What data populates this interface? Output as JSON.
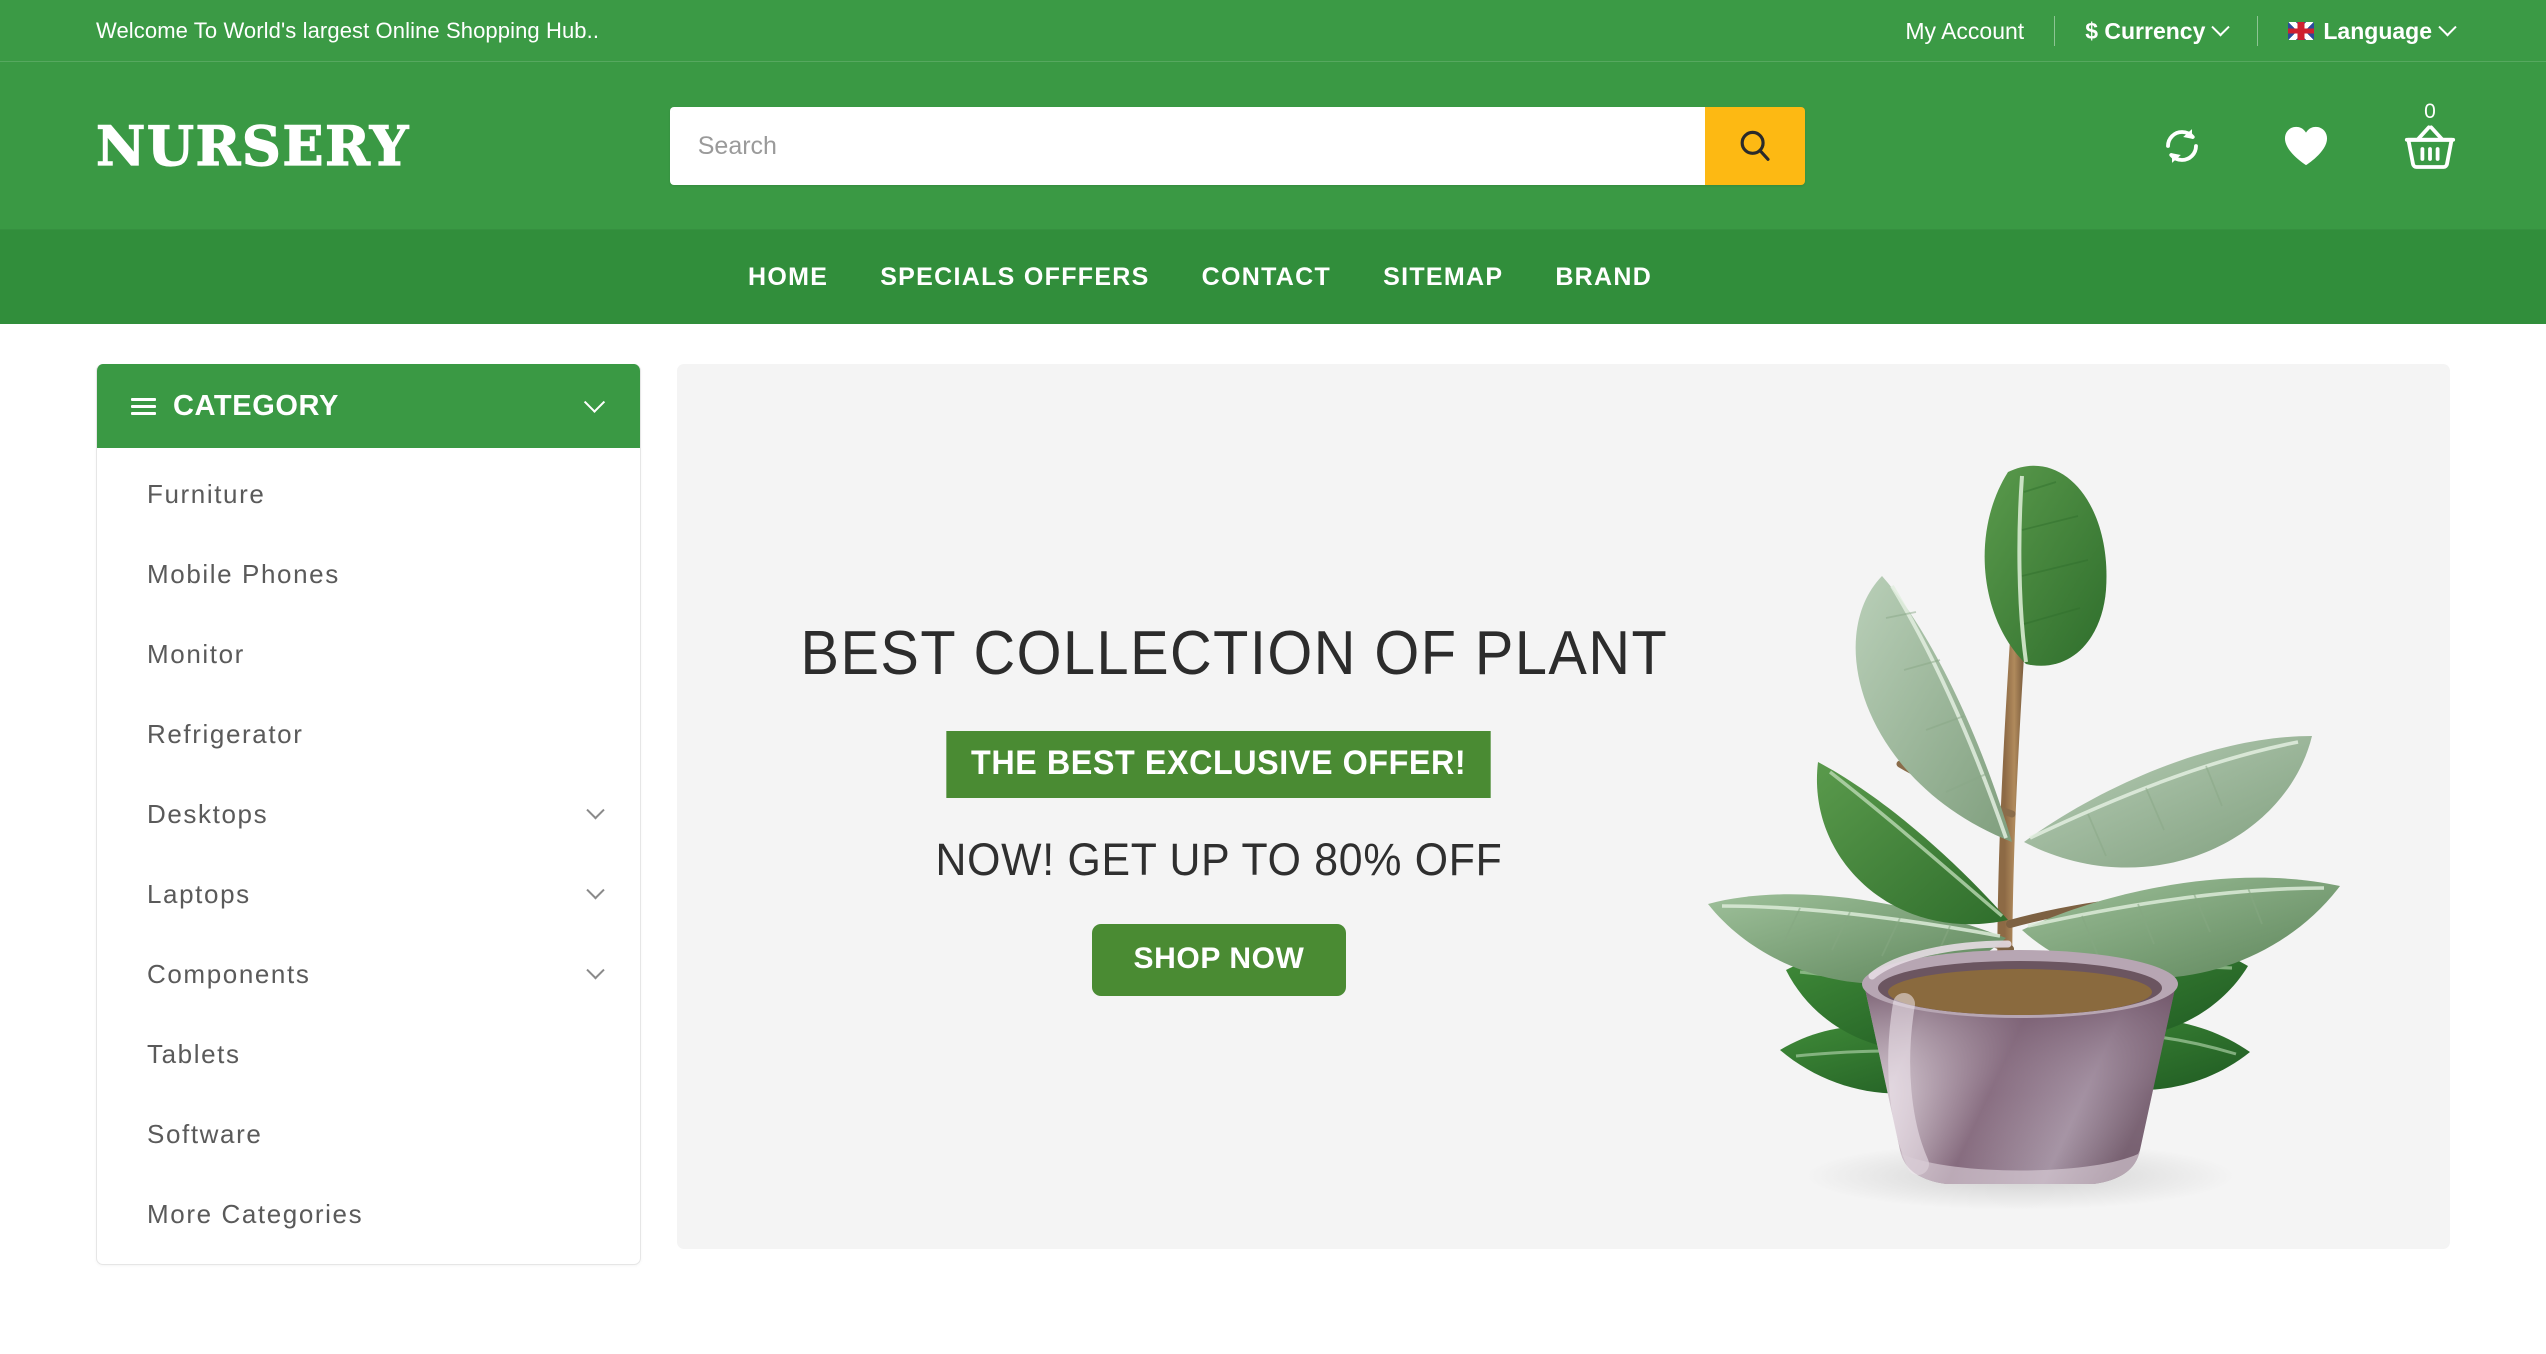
{
  "topbar": {
    "welcome": "Welcome To World's largest Online Shopping Hub..",
    "my_account": "My Account",
    "currency": "$ Currency",
    "language": "Language",
    "flag_icon": "uk-flag-icon",
    "caret_icon": "chevron-down-icon"
  },
  "header": {
    "logo": "NURSERY",
    "search_placeholder": "Search",
    "search_value": "",
    "search_icon": "search-icon",
    "compare_icon": "compare-refresh-icon",
    "wishlist_icon": "heart-icon",
    "cart_icon": "shopping-basket-icon",
    "cart_count": "0"
  },
  "nav": {
    "items": [
      {
        "label": "HOME"
      },
      {
        "label": "SPECIALS OFFFERS"
      },
      {
        "label": "CONTACT"
      },
      {
        "label": "SITEMAP"
      },
      {
        "label": "BRAND"
      }
    ]
  },
  "sidebar": {
    "title": "CATEGORY",
    "menu_icon": "hamburger-icon",
    "toggle_icon": "chevron-down-icon",
    "items": [
      {
        "label": "Furniture",
        "has_submenu": false
      },
      {
        "label": "Mobile Phones",
        "has_submenu": false
      },
      {
        "label": "Monitor",
        "has_submenu": false
      },
      {
        "label": "Refrigerator",
        "has_submenu": false
      },
      {
        "label": "Desktops",
        "has_submenu": true
      },
      {
        "label": "Laptops",
        "has_submenu": true
      },
      {
        "label": "Components",
        "has_submenu": true
      },
      {
        "label": "Tablets",
        "has_submenu": false
      },
      {
        "label": "Software",
        "has_submenu": false
      },
      {
        "label": "More Categories",
        "has_submenu": false
      }
    ]
  },
  "banner": {
    "heading": "BEST COLLECTION OF PLANT",
    "tagline": "THE BEST EXCLUSIVE OFFER!",
    "subheading": "NOW! GET UP TO 80% OFF",
    "cta_label": "SHOP NOW",
    "image_alt": "rubber-plant-in-pot-image"
  },
  "colors": {
    "brand_green": "#3a9944",
    "nav_green": "#318e3b",
    "accent_amber": "#fdb913",
    "banner_green": "#4a8b33",
    "banner_bg": "#f4f4f4"
  }
}
